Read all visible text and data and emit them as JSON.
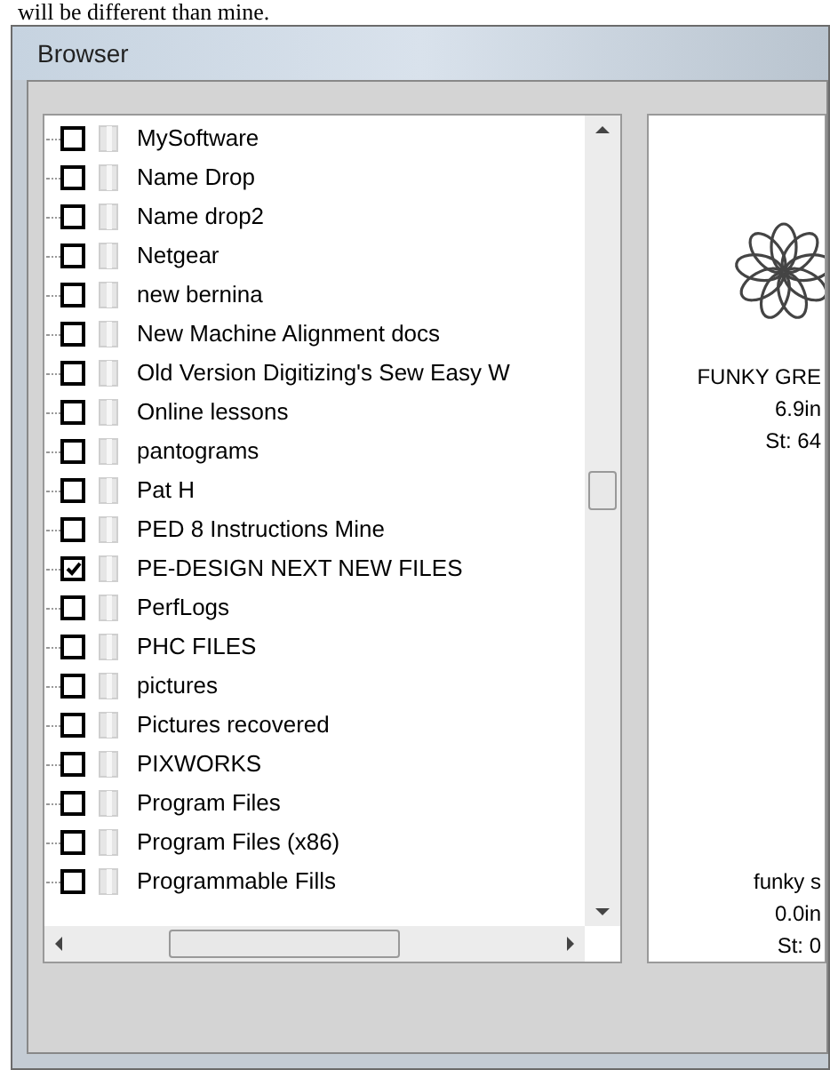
{
  "caption": "will be different than mine.",
  "window": {
    "title": "Browser"
  },
  "folders": [
    {
      "name": "MySoftware",
      "checked": false
    },
    {
      "name": "Name Drop",
      "checked": false
    },
    {
      "name": "Name drop2",
      "checked": false
    },
    {
      "name": "Netgear",
      "checked": false
    },
    {
      "name": "new bernina",
      "checked": false
    },
    {
      "name": "New Machine Alignment docs",
      "checked": false
    },
    {
      "name": "Old Version Digitizing's Sew Easy W",
      "checked": false
    },
    {
      "name": "Online lessons",
      "checked": false
    },
    {
      "name": "pantograms",
      "checked": false
    },
    {
      "name": "Pat H",
      "checked": false
    },
    {
      "name": "PED 8 Instructions Mine",
      "checked": false
    },
    {
      "name": "PE-DESIGN NEXT NEW FILES",
      "checked": true
    },
    {
      "name": "PerfLogs",
      "checked": false
    },
    {
      "name": "PHC FILES",
      "checked": false
    },
    {
      "name": "pictures",
      "checked": false
    },
    {
      "name": "Pictures recovered",
      "checked": false
    },
    {
      "name": "PIXWORKS",
      "checked": false
    },
    {
      "name": "Program Files",
      "checked": false
    },
    {
      "name": "Program Files (x86)",
      "checked": false
    },
    {
      "name": "Programmable Fills",
      "checked": false
    }
  ],
  "previews": [
    {
      "kind": "drawing",
      "lines": [
        "FUNKY GRE",
        "6.9in",
        "St: 64"
      ]
    },
    {
      "kind": "empty",
      "lines": [
        "funky s",
        "0.0in",
        "St: 0"
      ]
    }
  ]
}
